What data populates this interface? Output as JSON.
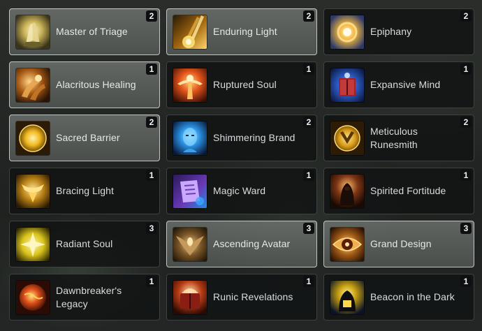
{
  "cards": [
    {
      "name": "Master of Triage",
      "rank": "2",
      "selected": true,
      "icon": "praying-hands-icon"
    },
    {
      "name": "Enduring Light",
      "rank": "2",
      "selected": true,
      "icon": "light-beam-icon"
    },
    {
      "name": "Epiphany",
      "rank": "2",
      "selected": false,
      "icon": "radiant-burst-icon"
    },
    {
      "name": "Alacritous Healing",
      "rank": "1",
      "selected": true,
      "icon": "glowing-hands-icon"
    },
    {
      "name": "Ruptured Soul",
      "rank": "1",
      "selected": false,
      "icon": "flaming-figure-icon"
    },
    {
      "name": "Expansive Mind",
      "rank": "1",
      "selected": false,
      "icon": "arcane-tome-icon"
    },
    {
      "name": "Sacred Barrier",
      "rank": "2",
      "selected": true,
      "icon": "golden-sun-icon"
    },
    {
      "name": "Shimmering Brand",
      "rank": "2",
      "selected": false,
      "icon": "spectral-face-icon"
    },
    {
      "name": "Meticulous Runesmith",
      "rank": "2",
      "selected": false,
      "icon": "lion-emblem-icon"
    },
    {
      "name": "Bracing Light",
      "rank": "1",
      "selected": false,
      "icon": "light-crest-icon"
    },
    {
      "name": "Magic Ward",
      "rank": "1",
      "selected": false,
      "icon": "magic-scroll-icon"
    },
    {
      "name": "Spirited Fortitude",
      "rank": "1",
      "selected": false,
      "icon": "hooded-figure-icon"
    },
    {
      "name": "Radiant Soul",
      "rank": "3",
      "selected": false,
      "icon": "radiant-sigil-icon"
    },
    {
      "name": "Ascending Avatar",
      "rank": "3",
      "selected": true,
      "icon": "avatar-wings-icon"
    },
    {
      "name": "Grand Design",
      "rank": "3",
      "selected": true,
      "icon": "golden-eye-icon"
    },
    {
      "name": "Dawnbreaker's Legacy",
      "rank": "1",
      "selected": false,
      "icon": "fire-orb-icon"
    },
    {
      "name": "Runic Revelations",
      "rank": "1",
      "selected": false,
      "icon": "glowing-tome-icon"
    },
    {
      "name": "Beacon in the Dark",
      "rank": "1",
      "selected": false,
      "icon": "beacon-silhouette-icon"
    }
  ]
}
